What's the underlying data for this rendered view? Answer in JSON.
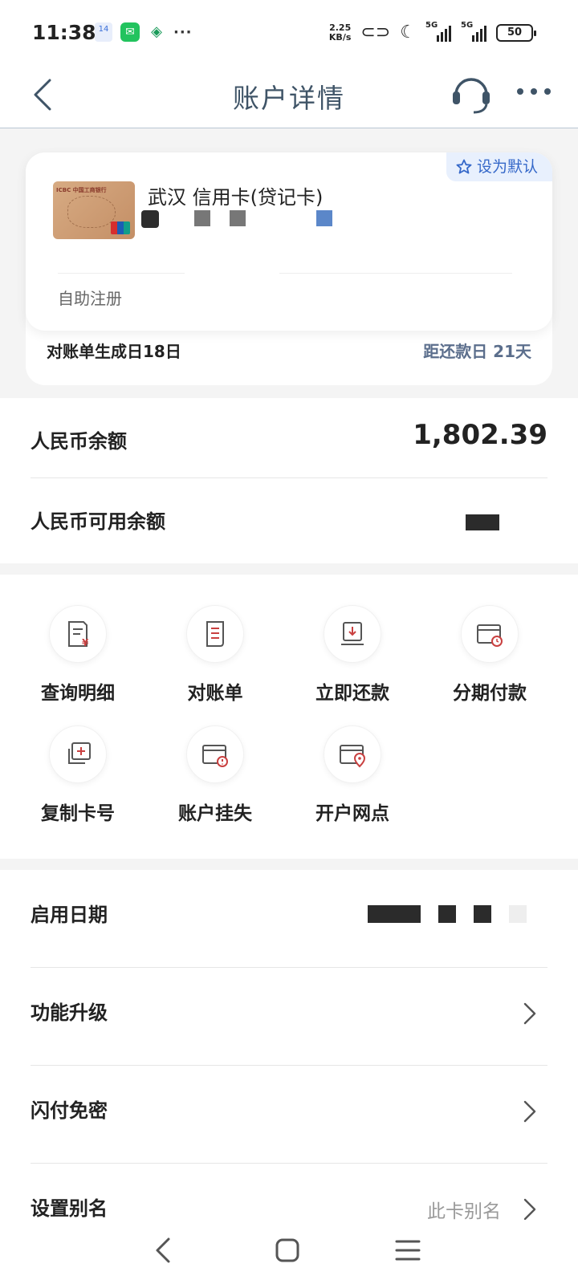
{
  "status_bar": {
    "time": "11:38",
    "calendar_day": "14",
    "speed_value": "2.25",
    "speed_unit": "KB/s",
    "network_1": "5G",
    "network_2": "5G",
    "battery": "50",
    "more": "···"
  },
  "header": {
    "title": "账户详情"
  },
  "card": {
    "set_default_label": "设为默认",
    "name": "武汉 信用卡(贷记卡)",
    "registration": "自助注册",
    "bill_day": "对账单生成日18日",
    "repay_day": "距还款日 21天",
    "bank_mark": "ICBC 中国工商银行"
  },
  "balances": {
    "rmb_balance_label": "人民币余额",
    "rmb_balance_value": "1,802.39",
    "rmb_available_label": "人民币可用余额"
  },
  "functions": [
    {
      "label": "查询明细",
      "icon": "detail-bill-icon"
    },
    {
      "label": "对账单",
      "icon": "statement-icon"
    },
    {
      "label": "立即还款",
      "icon": "repay-icon"
    },
    {
      "label": "分期付款",
      "icon": "installment-icon"
    },
    {
      "label": "复制卡号",
      "icon": "copy-card-icon"
    },
    {
      "label": "账户挂失",
      "icon": "report-loss-icon"
    },
    {
      "label": "开户网点",
      "icon": "branch-location-icon"
    }
  ],
  "settings": {
    "activation_date_label": "启用日期",
    "upgrade_label": "功能升级",
    "quick_pay_label": "闪付免密",
    "alias_label": "设置别名",
    "alias_value": "此卡别名"
  },
  "colors": {
    "title": "#3f5467",
    "accent_blue": "#3568c9",
    "icon_red": "#c94040"
  }
}
